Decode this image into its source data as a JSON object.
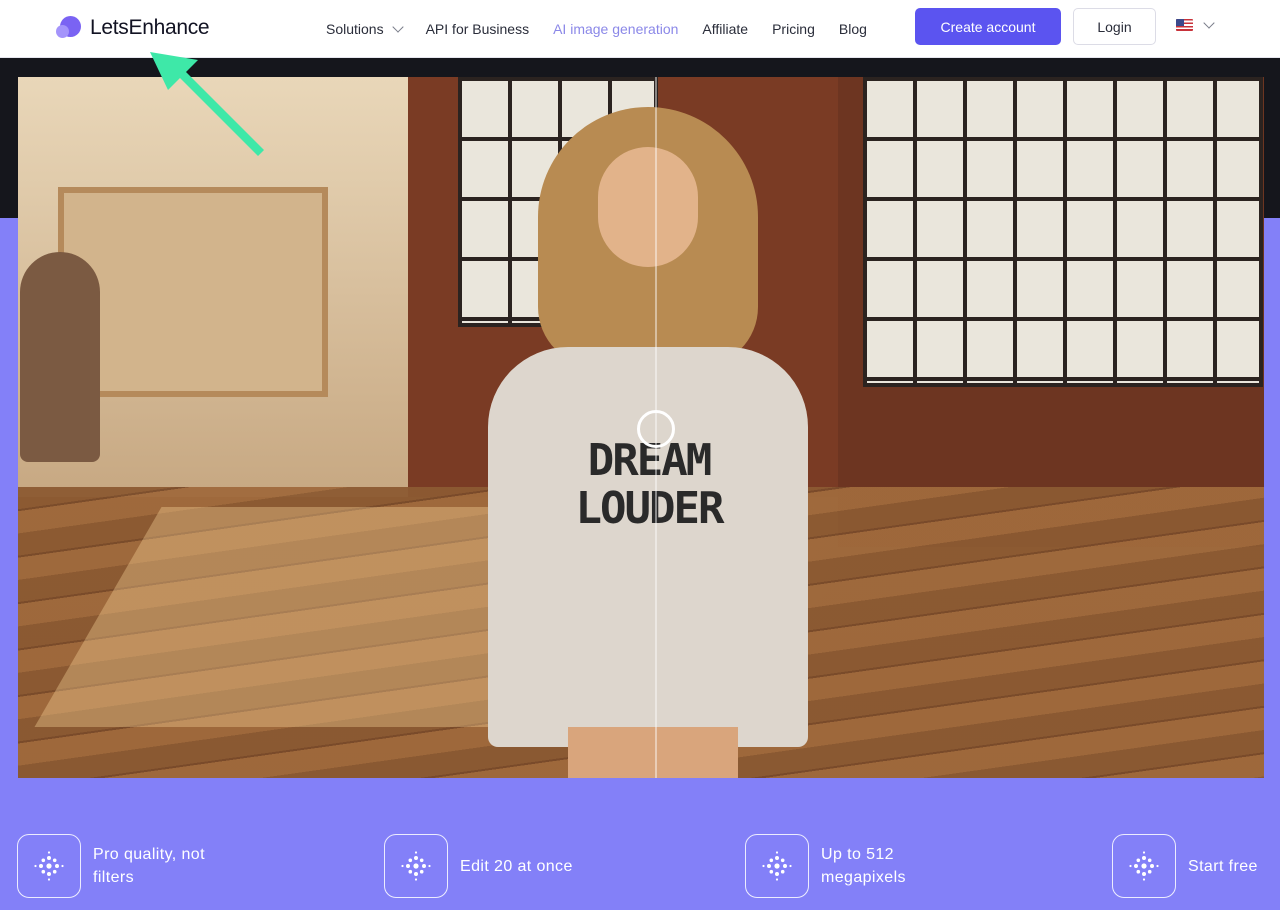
{
  "brand": {
    "name": "LetsEnhance"
  },
  "nav": {
    "items": [
      {
        "label": "Solutions",
        "has_dropdown": true
      },
      {
        "label": "API for Business"
      },
      {
        "label": "AI image generation",
        "muted": true
      },
      {
        "label": "Affiliate"
      },
      {
        "label": "Pricing"
      },
      {
        "label": "Blog"
      }
    ],
    "create_account": "Create account",
    "login": "Login",
    "language_icon": "us-flag-icon"
  },
  "hero": {
    "shirt_line1": "DREAM",
    "shirt_line2": "LOUDER",
    "compare_handle_icon": "circle-handle-icon"
  },
  "features": [
    {
      "text": "Pro quality, not filters",
      "icon": "dot-cluster-icon"
    },
    {
      "text": "Edit 20 at once",
      "icon": "dot-cluster-icon"
    },
    {
      "text": "Up to 512 megapixels",
      "icon": "dot-cluster-icon"
    },
    {
      "text": "Start free",
      "icon": "dot-cluster-icon"
    }
  ],
  "colors": {
    "accent": "#5b54f0",
    "hero_background": "#8380f8",
    "arrow": "#3ee8a8"
  }
}
